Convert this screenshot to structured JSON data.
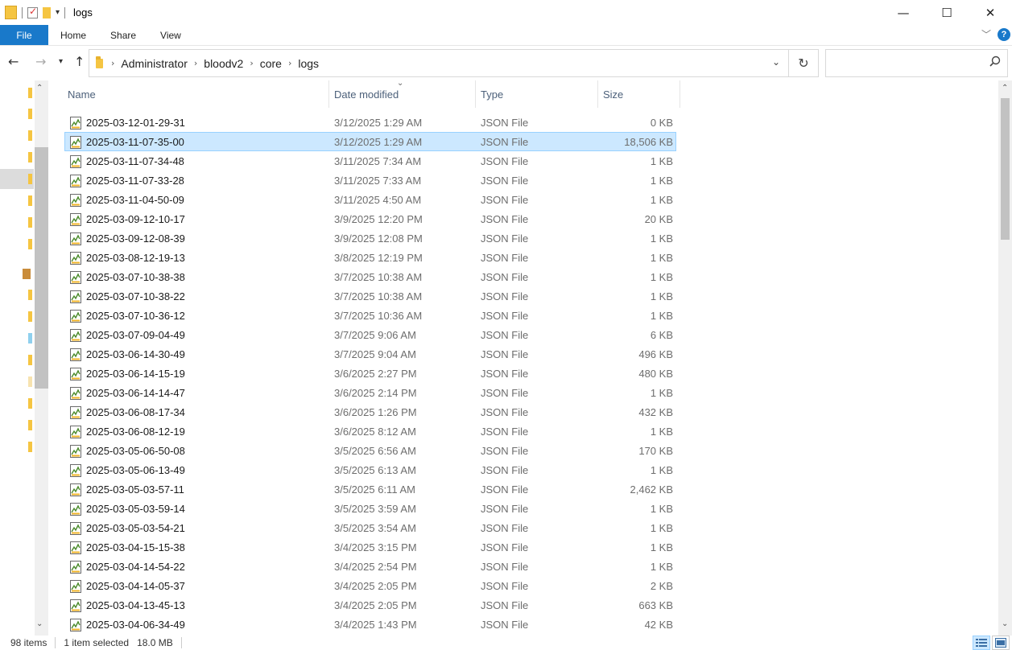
{
  "window": {
    "title": "logs",
    "minimize_glyph": "—",
    "maximize_glyph": "☐",
    "close_glyph": "✕"
  },
  "ribbon": {
    "tabs": [
      "File",
      "Home",
      "Share",
      "View"
    ],
    "help_label": "?"
  },
  "address": {
    "crumbs": [
      "Administrator",
      "bloodv2",
      "core",
      "logs"
    ],
    "search_placeholder": ""
  },
  "columns": {
    "name": "Name",
    "date": "Date modified",
    "type": "Type",
    "size": "Size"
  },
  "icons": {
    "file": "json-file-icon",
    "back": "back-arrow-icon",
    "forward": "forward-arrow-icon",
    "up": "up-arrow-icon",
    "refresh": "refresh-icon",
    "search": "search-icon"
  },
  "colors": {
    "accent": "#1979ca",
    "selection_bg": "#cce8ff",
    "selection_border": "#99d1ff"
  },
  "files": [
    {
      "name": "2025-03-12-01-29-31",
      "date": "3/12/2025 1:29 AM",
      "type": "JSON File",
      "size": "0 KB",
      "selected": false
    },
    {
      "name": "2025-03-11-07-35-00",
      "date": "3/12/2025 1:29 AM",
      "type": "JSON File",
      "size": "18,506 KB",
      "selected": true
    },
    {
      "name": "2025-03-11-07-34-48",
      "date": "3/11/2025 7:34 AM",
      "type": "JSON File",
      "size": "1 KB",
      "selected": false
    },
    {
      "name": "2025-03-11-07-33-28",
      "date": "3/11/2025 7:33 AM",
      "type": "JSON File",
      "size": "1 KB",
      "selected": false
    },
    {
      "name": "2025-03-11-04-50-09",
      "date": "3/11/2025 4:50 AM",
      "type": "JSON File",
      "size": "1 KB",
      "selected": false
    },
    {
      "name": "2025-03-09-12-10-17",
      "date": "3/9/2025 12:20 PM",
      "type": "JSON File",
      "size": "20 KB",
      "selected": false
    },
    {
      "name": "2025-03-09-12-08-39",
      "date": "3/9/2025 12:08 PM",
      "type": "JSON File",
      "size": "1 KB",
      "selected": false
    },
    {
      "name": "2025-03-08-12-19-13",
      "date": "3/8/2025 12:19 PM",
      "type": "JSON File",
      "size": "1 KB",
      "selected": false
    },
    {
      "name": "2025-03-07-10-38-38",
      "date": "3/7/2025 10:38 AM",
      "type": "JSON File",
      "size": "1 KB",
      "selected": false
    },
    {
      "name": "2025-03-07-10-38-22",
      "date": "3/7/2025 10:38 AM",
      "type": "JSON File",
      "size": "1 KB",
      "selected": false
    },
    {
      "name": "2025-03-07-10-36-12",
      "date": "3/7/2025 10:36 AM",
      "type": "JSON File",
      "size": "1 KB",
      "selected": false
    },
    {
      "name": "2025-03-07-09-04-49",
      "date": "3/7/2025 9:06 AM",
      "type": "JSON File",
      "size": "6 KB",
      "selected": false
    },
    {
      "name": "2025-03-06-14-30-49",
      "date": "3/7/2025 9:04 AM",
      "type": "JSON File",
      "size": "496 KB",
      "selected": false
    },
    {
      "name": "2025-03-06-14-15-19",
      "date": "3/6/2025 2:27 PM",
      "type": "JSON File",
      "size": "480 KB",
      "selected": false
    },
    {
      "name": "2025-03-06-14-14-47",
      "date": "3/6/2025 2:14 PM",
      "type": "JSON File",
      "size": "1 KB",
      "selected": false
    },
    {
      "name": "2025-03-06-08-17-34",
      "date": "3/6/2025 1:26 PM",
      "type": "JSON File",
      "size": "432 KB",
      "selected": false
    },
    {
      "name": "2025-03-06-08-12-19",
      "date": "3/6/2025 8:12 AM",
      "type": "JSON File",
      "size": "1 KB",
      "selected": false
    },
    {
      "name": "2025-03-05-06-50-08",
      "date": "3/5/2025 6:56 AM",
      "type": "JSON File",
      "size": "170 KB",
      "selected": false
    },
    {
      "name": "2025-03-05-06-13-49",
      "date": "3/5/2025 6:13 AM",
      "type": "JSON File",
      "size": "1 KB",
      "selected": false
    },
    {
      "name": "2025-03-05-03-57-11",
      "date": "3/5/2025 6:11 AM",
      "type": "JSON File",
      "size": "2,462 KB",
      "selected": false
    },
    {
      "name": "2025-03-05-03-59-14",
      "date": "3/5/2025 3:59 AM",
      "type": "JSON File",
      "size": "1 KB",
      "selected": false
    },
    {
      "name": "2025-03-05-03-54-21",
      "date": "3/5/2025 3:54 AM",
      "type": "JSON File",
      "size": "1 KB",
      "selected": false
    },
    {
      "name": "2025-03-04-15-15-38",
      "date": "3/4/2025 3:15 PM",
      "type": "JSON File",
      "size": "1 KB",
      "selected": false
    },
    {
      "name": "2025-03-04-14-54-22",
      "date": "3/4/2025 2:54 PM",
      "type": "JSON File",
      "size": "1 KB",
      "selected": false
    },
    {
      "name": "2025-03-04-14-05-37",
      "date": "3/4/2025 2:05 PM",
      "type": "JSON File",
      "size": "2 KB",
      "selected": false
    },
    {
      "name": "2025-03-04-13-45-13",
      "date": "3/4/2025 2:05 PM",
      "type": "JSON File",
      "size": "663 KB",
      "selected": false
    },
    {
      "name": "2025-03-04-06-34-49",
      "date": "3/4/2025 1:43 PM",
      "type": "JSON File",
      "size": "42 KB",
      "selected": false
    }
  ],
  "status": {
    "item_count": "98 items",
    "selection": "1 item selected",
    "selection_size": "18.0 MB"
  }
}
